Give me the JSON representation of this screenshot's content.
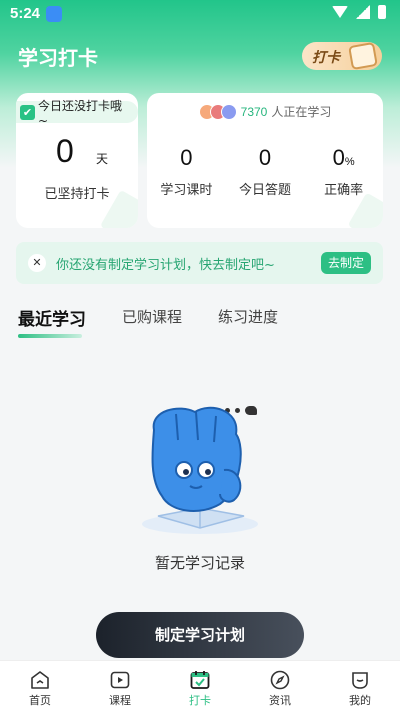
{
  "status_bar": {
    "time": "5:24"
  },
  "header": {
    "title": "学习打卡",
    "badge_label": "打卡"
  },
  "checkin_card": {
    "tag": "今日还没打卡哦~",
    "days": "0",
    "unit": "天",
    "caption": "已坚持打卡"
  },
  "stats_card": {
    "learners_count": "7370",
    "learners_label": "人正在学习",
    "stats": [
      {
        "value": "0",
        "suffix": "",
        "label": "学习课时"
      },
      {
        "value": "0",
        "suffix": "",
        "label": "今日答题"
      },
      {
        "value": "0",
        "suffix": "%",
        "label": "正确率"
      }
    ]
  },
  "plan_banner": {
    "message": "你还没有制定学习计划，快去制定吧~",
    "action": "去制定"
  },
  "tabs": [
    {
      "label": "最近学习",
      "active": true
    },
    {
      "label": "已购课程",
      "active": false
    },
    {
      "label": "练习进度",
      "active": false
    }
  ],
  "empty_state": {
    "text": "暂无学习记录"
  },
  "primary_button": {
    "label": "制定学习计划"
  },
  "bottom_nav": [
    {
      "label": "首页",
      "icon": "home-icon",
      "active": false
    },
    {
      "label": "课程",
      "icon": "play-icon",
      "active": false
    },
    {
      "label": "打卡",
      "icon": "calendar-check-icon",
      "active": true
    },
    {
      "label": "资讯",
      "icon": "compass-icon",
      "active": false
    },
    {
      "label": "我的",
      "icon": "user-icon",
      "active": false
    }
  ],
  "colors": {
    "accent": "#2dbf84",
    "dark_button": "#1c222b"
  }
}
